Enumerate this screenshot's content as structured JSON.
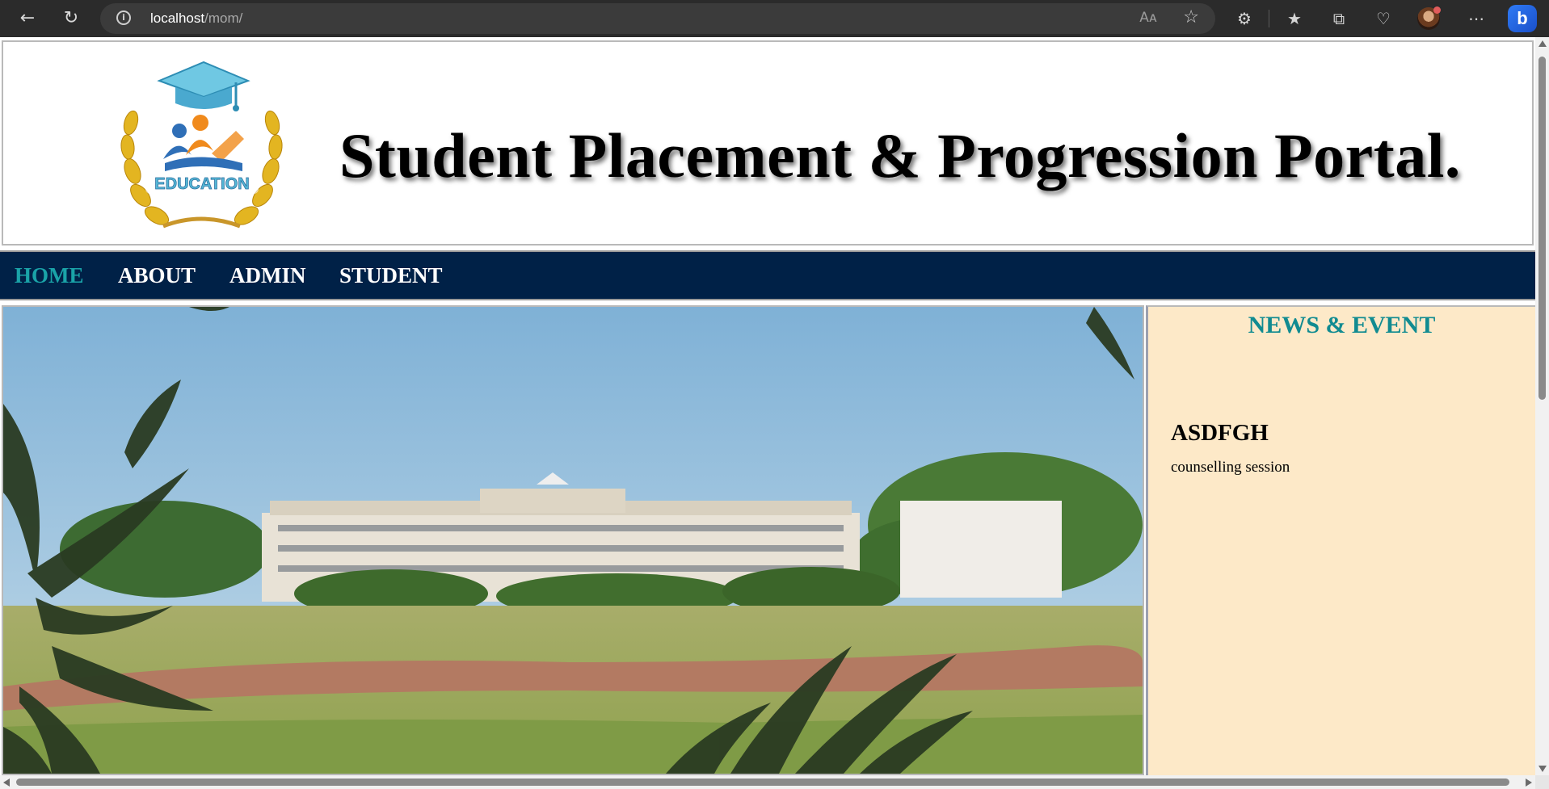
{
  "browser": {
    "url_host": "localhost",
    "url_path": "/mom/",
    "info_icon": "info-icon",
    "read_aloud_label": "Aᴀ",
    "icons": [
      "back-icon",
      "refresh-icon",
      "info-icon",
      "read-aloud-icon",
      "favorite-star-icon",
      "extensions-icon",
      "favorites-icon",
      "collections-icon",
      "browser-essentials-icon",
      "profile-avatar",
      "more-icon",
      "bing-copilot-icon"
    ],
    "bing_label": "b"
  },
  "header": {
    "logo_text": "EDUCATION",
    "title": "Student Placement & Progression Portal."
  },
  "menu": {
    "items": [
      {
        "label": "HOME",
        "active": true
      },
      {
        "label": "ABOUT",
        "active": false
      },
      {
        "label": "ADMIN",
        "active": false
      },
      {
        "label": "STUDENT",
        "active": false
      }
    ],
    "active_color": "#1aa3a8",
    "background": "#002147"
  },
  "news": {
    "heading": "NEWS & EVENT",
    "items": [
      {
        "title": "ASDFGH",
        "description": "counselling session"
      }
    ],
    "background": "#fde9c8",
    "heading_color": "#118b91"
  }
}
